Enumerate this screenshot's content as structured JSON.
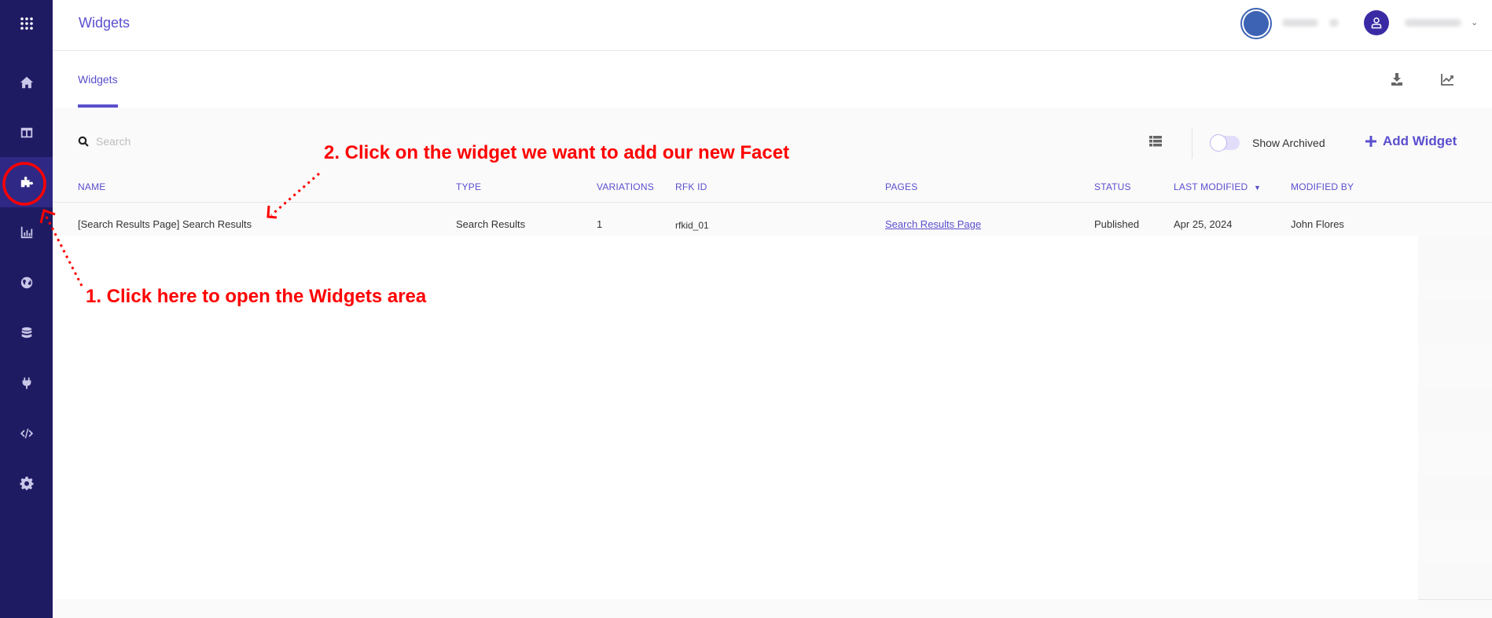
{
  "header": {
    "title": "Widgets"
  },
  "sidebar": {
    "items": [
      {
        "name": "apps",
        "icon": "grid-icon"
      },
      {
        "name": "home",
        "icon": "home-icon"
      },
      {
        "name": "dashboard",
        "icon": "columns-icon"
      },
      {
        "name": "widgets",
        "icon": "puzzle-icon",
        "active": true
      },
      {
        "name": "analytics",
        "icon": "bar-chart-icon"
      },
      {
        "name": "global",
        "icon": "globe-icon"
      },
      {
        "name": "data",
        "icon": "database-icon"
      },
      {
        "name": "integrations",
        "icon": "plug-icon"
      },
      {
        "name": "developer",
        "icon": "code-icon"
      },
      {
        "name": "settings",
        "icon": "gear-icon"
      }
    ]
  },
  "tabs": [
    {
      "label": "Widgets",
      "active": true
    }
  ],
  "tab_actions": [
    {
      "icon": "download-icon"
    },
    {
      "icon": "trend-chart-icon"
    }
  ],
  "toolbar": {
    "search_placeholder": "Search",
    "search_value": "",
    "show_archived_label": "Show Archived",
    "show_archived": false,
    "add_widget_label": "Add Widget"
  },
  "table": {
    "columns": [
      "Name",
      "Type",
      "Variations",
      "RFK ID",
      "Pages",
      "Status",
      "Last Modified",
      "Modified By"
    ],
    "sorted_column": "Last Modified",
    "sort_direction": "desc",
    "rows": [
      {
        "name": "[Search Results Page] Search Results",
        "type": "Search Results",
        "variations": "1",
        "rfk_id": "rfkid_01",
        "pages": "Search Results Page",
        "status": "Published",
        "last_modified": "Apr 25, 2024",
        "modified_by": "John Flores"
      }
    ]
  },
  "annotations": {
    "step1": "1. Click here to open the Widgets area",
    "step2": "2. Click on the widget we want to add our new Facet"
  },
  "colors": {
    "accent": "#5a4fcf",
    "sidebar_bg": "#1f1b63",
    "sidebar_active": "#2f2985",
    "annotation": "#ff0000"
  }
}
